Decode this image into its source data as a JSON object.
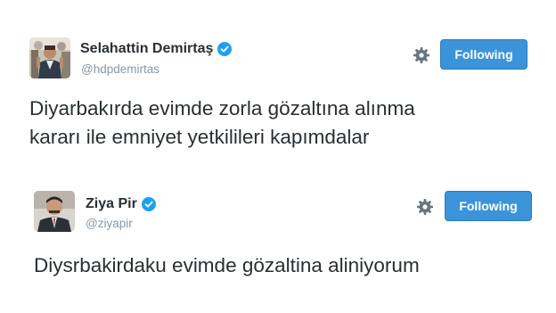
{
  "tweets": [
    {
      "name": "Selahattin Demirtaş",
      "handle": "@hdpdemirtas",
      "follow_label": "Following",
      "text_lines": [
        "Diyarbakırda evimde zorla gözaltına alınma",
        "kararı ile emniyet yetkilileri kapımdalar"
      ],
      "avatar": "person-photo-crowd",
      "verified": true
    },
    {
      "name": "Ziya Pir",
      "handle": "@ziyapir",
      "follow_label": "Following",
      "text_lines": [
        "Diysrbakirdaku evimde gözaltina aliniyorum"
      ],
      "avatar": "person-photo-suit",
      "verified": true
    }
  ],
  "colors": {
    "button": "#3b94d9",
    "verified": "#1da1f2",
    "handle": "#8899a6",
    "text": "#292f33"
  }
}
